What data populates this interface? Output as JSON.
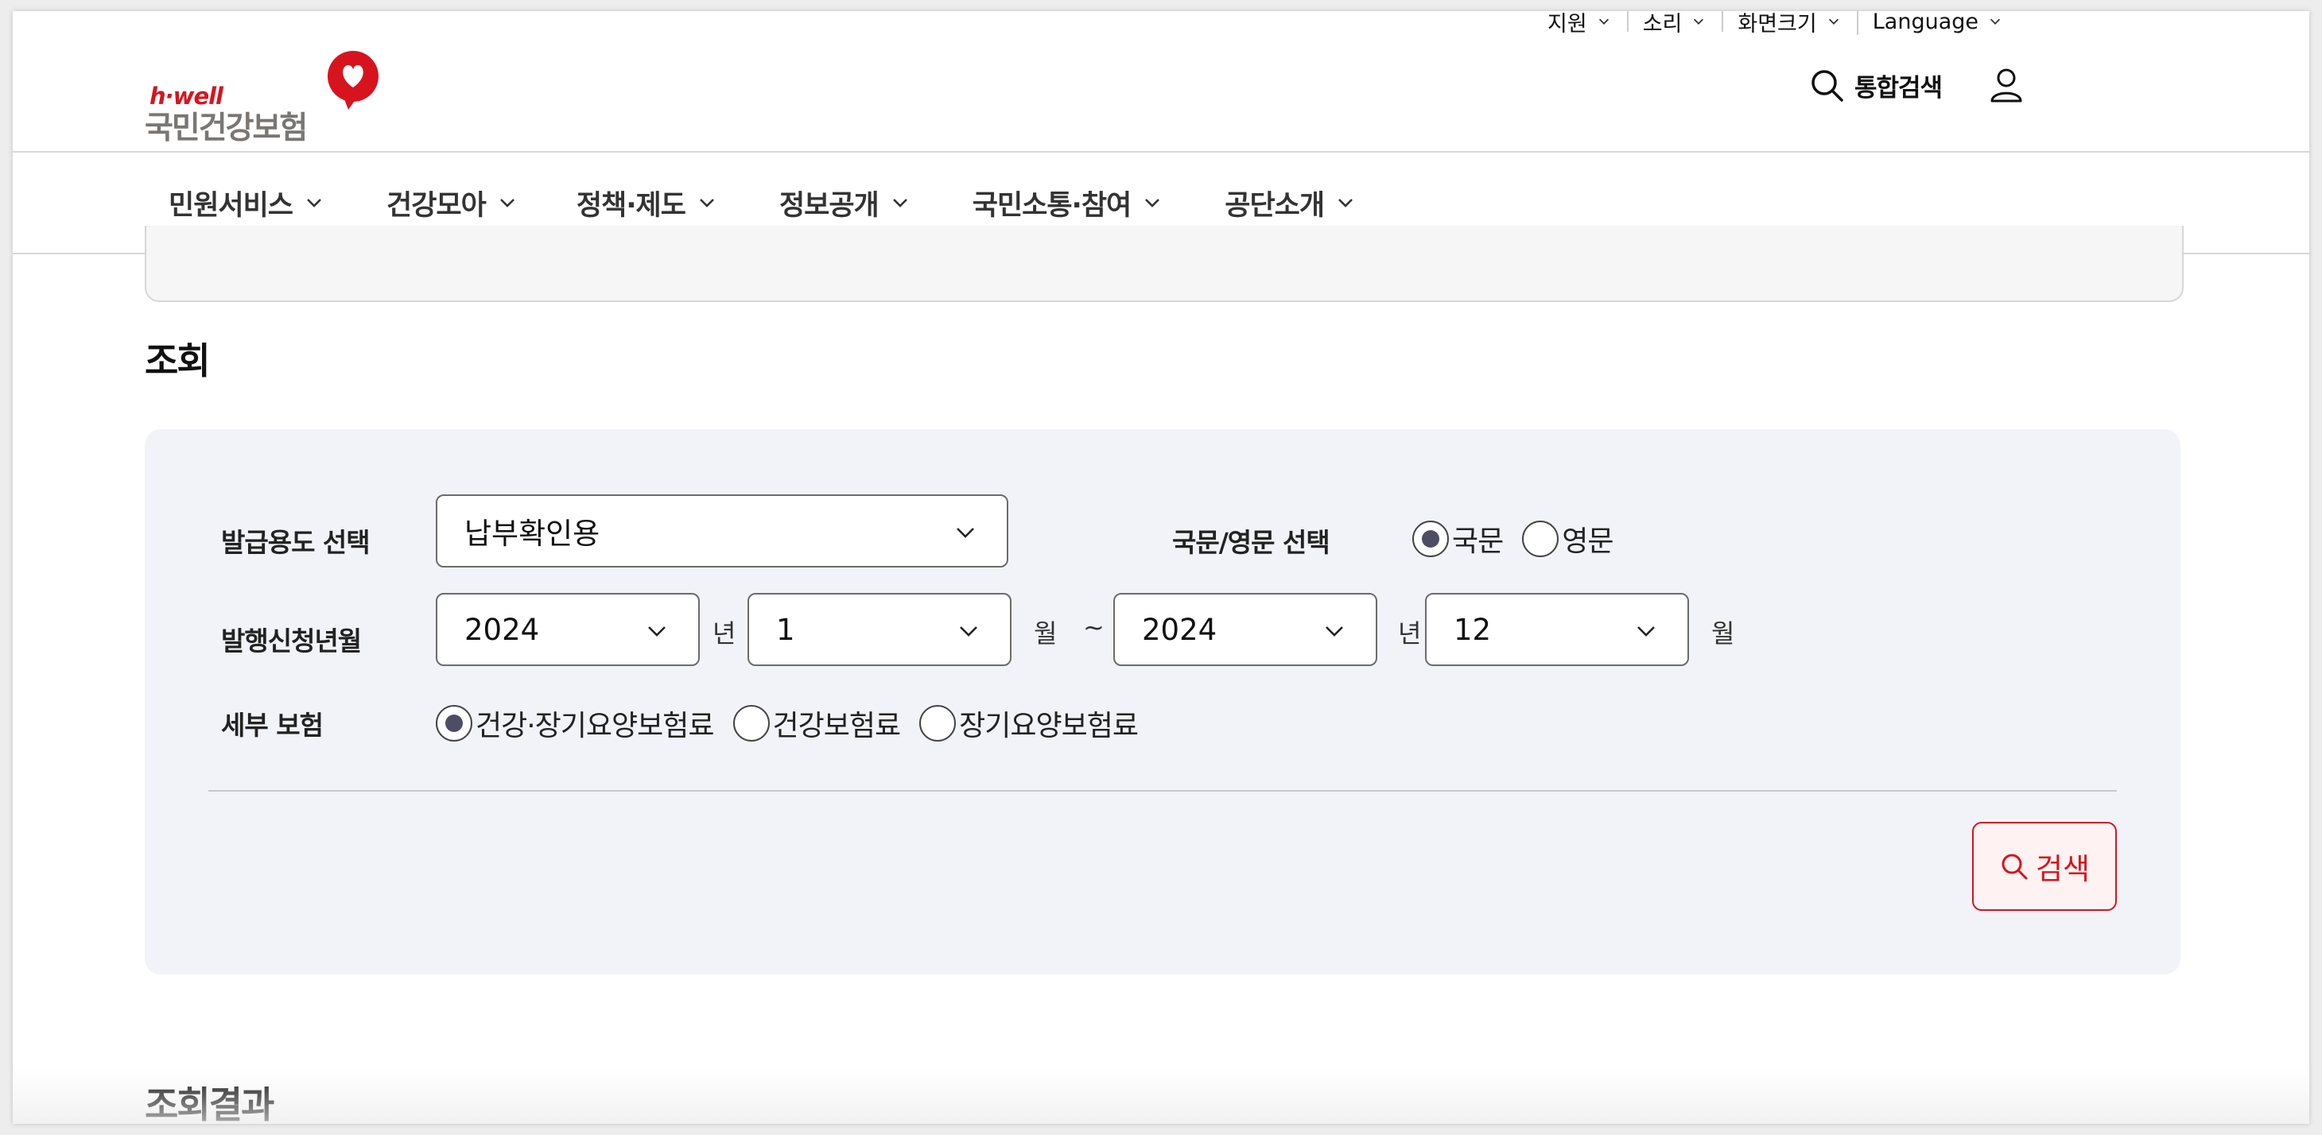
{
  "utility_nav": [
    {
      "label": "지원"
    },
    {
      "label": "소리"
    },
    {
      "label": "화면크기"
    },
    {
      "label": "Language"
    }
  ],
  "logo": {
    "english": "h·well",
    "korean": "국민건강보험",
    "brand_red": "#d7141d",
    "brand_gray": "#7a7672"
  },
  "header": {
    "integrated_search": "통합검색",
    "search_icon": "search-icon",
    "user_icon": "user-icon"
  },
  "gnb": [
    {
      "label": "민원서비스"
    },
    {
      "label": "건강모아"
    },
    {
      "label": "정책·제도"
    },
    {
      "label": "정보공개"
    },
    {
      "label": "국민소통·참여"
    },
    {
      "label": "공단소개"
    }
  ],
  "search_section": {
    "title": "조회",
    "purpose": {
      "label": "발급용도 선택",
      "value": "납부확인용"
    },
    "language": {
      "label": "국문/영문 선택",
      "options": [
        {
          "label": "국문",
          "selected": true
        },
        {
          "label": "영문",
          "selected": false
        }
      ]
    },
    "period": {
      "label": "발행신청년월",
      "from_year": "2024",
      "from_month": "1",
      "to_year": "2024",
      "to_month": "12",
      "year_unit": "년",
      "month_unit": "월",
      "separator": "~"
    },
    "insurance": {
      "label": "세부 보험",
      "options": [
        {
          "label": "건강·장기요양보험료",
          "selected": true
        },
        {
          "label": "건강보험료",
          "selected": false
        },
        {
          "label": "장기요양보험료",
          "selected": false
        }
      ]
    },
    "search_button": "검색",
    "accent_color": "#d7141d"
  },
  "result_section": {
    "title": "조회결과"
  }
}
